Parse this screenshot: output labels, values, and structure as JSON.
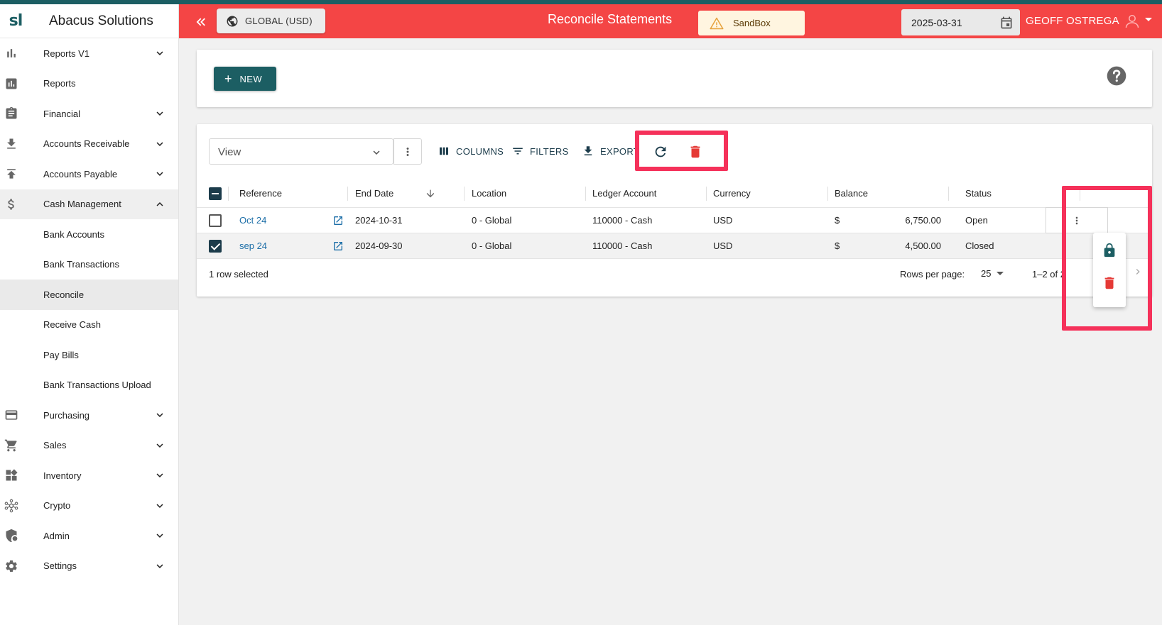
{
  "app": {
    "logo_text": "sl",
    "company_name": "Abacus Solutions"
  },
  "sidebar": {
    "items": [
      {
        "label": "Reports V1",
        "icon": "bar-chart-icon",
        "has_chevron": "down"
      },
      {
        "label": "Reports",
        "icon": "analytics-icon",
        "has_chevron": ""
      },
      {
        "label": "Financial",
        "icon": "clipboard-icon",
        "has_chevron": "down"
      },
      {
        "label": "Accounts Receivable",
        "icon": "download-icon",
        "has_chevron": "down"
      },
      {
        "label": "Accounts Payable",
        "icon": "upload-icon",
        "has_chevron": "down"
      },
      {
        "label": "Cash Management",
        "icon": "dollar-icon",
        "has_chevron": "up"
      }
    ],
    "sub_items": [
      {
        "label": "Bank Accounts"
      },
      {
        "label": "Bank Transactions"
      },
      {
        "label": "Reconcile",
        "active": true
      },
      {
        "label": "Receive Cash"
      },
      {
        "label": "Pay Bills"
      },
      {
        "label": "Bank Transactions Upload"
      }
    ],
    "items_after": [
      {
        "label": "Purchasing",
        "icon": "credit-card-icon"
      },
      {
        "label": "Sales",
        "icon": "cart-icon"
      },
      {
        "label": "Inventory",
        "icon": "dashboard-icon"
      },
      {
        "label": "Crypto",
        "icon": "network-icon"
      },
      {
        "label": "Admin",
        "icon": "shield-icon"
      },
      {
        "label": "Settings",
        "icon": "gear-icon"
      }
    ]
  },
  "header": {
    "global_label": "GLOBAL (USD)",
    "title": "Reconcile Statements",
    "sandbox_label": "SandBox",
    "date_value": "2025-03-31",
    "user_name": "GEOFF OSTREGA",
    "bg_color": "#f44545"
  },
  "actions": {
    "new_label": "NEW"
  },
  "toolbar": {
    "view_placeholder": "View",
    "columns_label": "COLUMNS",
    "filters_label": "FILTERS",
    "export_label": "EXPORT"
  },
  "table": {
    "headers": [
      "Reference",
      "End Date",
      "Location",
      "Ledger Account",
      "Currency",
      "Balance",
      "Status"
    ],
    "rows": [
      {
        "checked": false,
        "reference": "Oct 24",
        "end_date": "2024-10-31",
        "location": "0 - Global",
        "ledger_account": "110000 - Cash",
        "currency": "USD",
        "balance_symbol": "$",
        "balance": "6,750.00",
        "status": "Open"
      },
      {
        "checked": true,
        "reference": "sep 24",
        "end_date": "2024-09-30",
        "location": "0 - Global",
        "ledger_account": "110000 - Cash",
        "currency": "USD",
        "balance_symbol": "$",
        "balance": "4,500.00",
        "status": "Closed"
      }
    ],
    "selection_text": "1 row selected",
    "rows_per_page_label": "Rows per page:",
    "rows_per_page_value": "25",
    "page_info": "1–2 of 2"
  },
  "colors": {
    "accent": "#1c5e63",
    "highlight": "#f5315a",
    "danger": "#e53935"
  }
}
